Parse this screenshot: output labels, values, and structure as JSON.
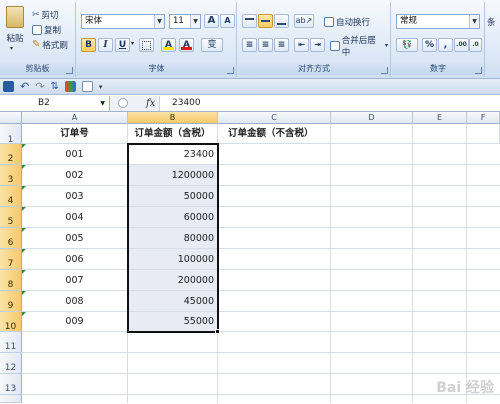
{
  "ribbon": {
    "clipboard": {
      "paste": "粘贴",
      "cut": "剪切",
      "copy": "复制",
      "format_painter": "格式刷",
      "label": "剪贴板"
    },
    "font": {
      "name": "宋体",
      "size": "11",
      "grow": "A",
      "shrink": "A",
      "bold": "B",
      "italic": "I",
      "underline": "U",
      "fill": "A",
      "color": "A",
      "phonetic": "变",
      "label": "字体"
    },
    "alignment": {
      "wrap": "自动换行",
      "merge": "合并后居中",
      "label": "对齐方式"
    },
    "number": {
      "format": "常规",
      "percent": "%",
      "comma": ",",
      "label": "数字"
    },
    "styles": {
      "label": "条"
    }
  },
  "formula_bar": {
    "name_box": "B2",
    "fx": "fx",
    "value": "23400"
  },
  "columns": [
    "A",
    "B",
    "C",
    "D",
    "E",
    "F"
  ],
  "rows": [
    "1",
    "2",
    "3",
    "4",
    "5",
    "6",
    "7",
    "8",
    "9",
    "10",
    "11",
    "12",
    "13"
  ],
  "sheet": {
    "headers": {
      "a": "订单号",
      "b": "订单金额（含税）",
      "c": "订单金额（不含税）"
    },
    "data": [
      {
        "id": "001",
        "amount": "23400"
      },
      {
        "id": "002",
        "amount": "1200000"
      },
      {
        "id": "003",
        "amount": "50000"
      },
      {
        "id": "004",
        "amount": "60000"
      },
      {
        "id": "005",
        "amount": "80000"
      },
      {
        "id": "006",
        "amount": "100000"
      },
      {
        "id": "007",
        "amount": "200000"
      },
      {
        "id": "008",
        "amount": "45000"
      },
      {
        "id": "009",
        "amount": "55000"
      }
    ]
  },
  "colors": {
    "selection_fill": "#e8ebf4",
    "header_highlight": "#f6c96a",
    "error_triangle": "#2e8b2e"
  },
  "watermark": "Bai 经验"
}
